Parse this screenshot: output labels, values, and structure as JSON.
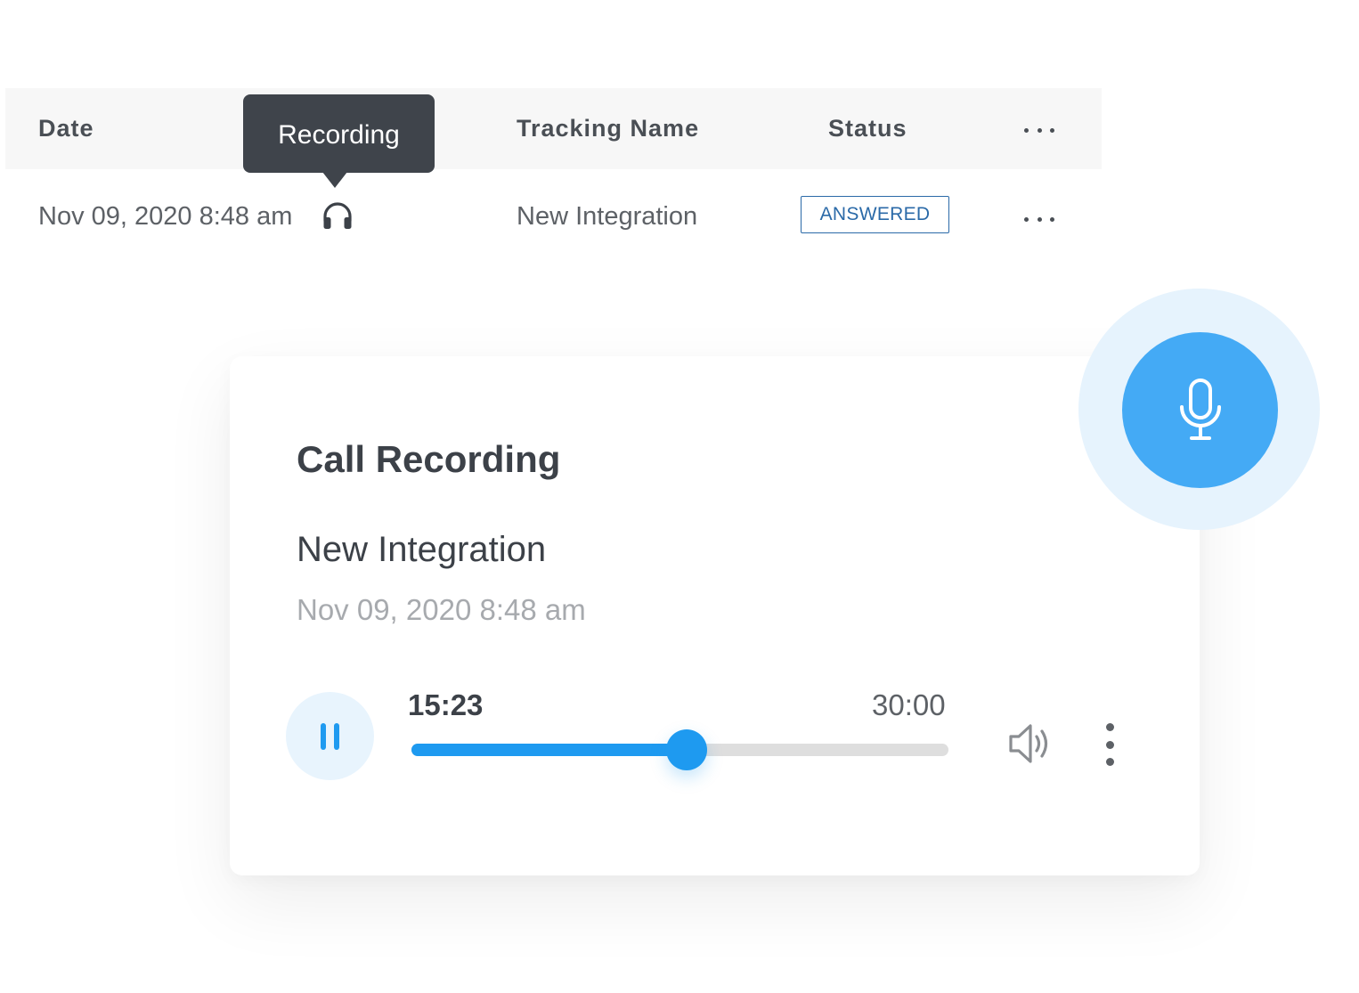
{
  "table": {
    "headers": {
      "date": "Date",
      "tracking_name": "Tracking Name",
      "status": "Status"
    },
    "row": {
      "date": "Nov 09, 2020 8:48 am",
      "tracking_name": "New Integration",
      "status": "ANSWERED"
    },
    "tooltip": "Recording"
  },
  "player": {
    "title": "Call Recording",
    "name": "New Integration",
    "date": "Nov 09, 2020 8:48 am",
    "current_time": "15:23",
    "total_time": "30:00",
    "progress": 0.513
  },
  "icons": {
    "recording": "headphones-icon",
    "pause": "pause-icon",
    "volume": "volume-icon",
    "more": "more-vertical-icon",
    "row_more": "more-horizontal-icon",
    "mic": "microphone-icon"
  },
  "colors": {
    "accent": "#1e9af0",
    "mic_blue": "#44aaf5",
    "status_blue": "#2b6aa8",
    "dark_text": "#3c4148"
  }
}
